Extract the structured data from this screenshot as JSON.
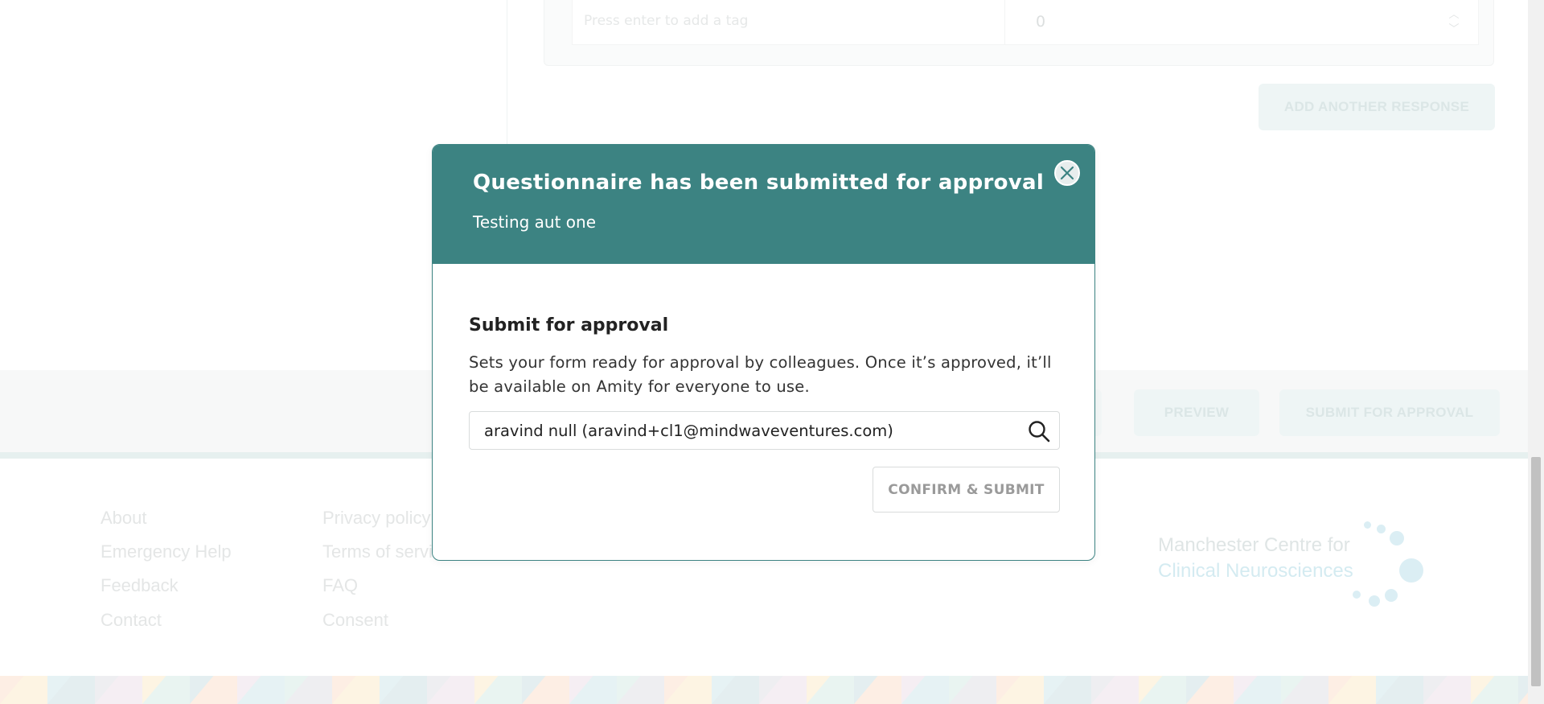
{
  "background": {
    "tag_input_placeholder": "Press enter to add a tag",
    "number_value": "0",
    "add_response_label": "ADD ANOTHER RESPONSE",
    "preview_label": "PREVIEW",
    "submit_for_approval_label": "SUBMIT FOR APPROVAL",
    "footer": {
      "col1": [
        "About",
        "Emergency Help",
        "Feedback",
        "Contact"
      ],
      "col2": [
        "Privacy policy",
        "Terms of service",
        "FAQ",
        "Consent"
      ]
    },
    "logo": {
      "line1": "Manchester Centre for",
      "line2": "Clinical Neurosciences"
    }
  },
  "modal": {
    "title": "Questionnaire has been submitted for approval",
    "subtitle": "Testing aut one",
    "heading": "Submit for approval",
    "description": "Sets your form ready for approval by colleagues. Once it’s approved, it’ll be available on Amity for everyone to use.",
    "approver_value": "aravind null (aravind+cl1@mindwaveventures.com)",
    "confirm_label": "CONFIRM & SUBMIT",
    "close_icon": "close-icon",
    "search_icon": "search-icon"
  },
  "colors": {
    "accent": "#3c8382",
    "heading_text": "#222222",
    "muted_button_text": "#9a9a9a"
  }
}
